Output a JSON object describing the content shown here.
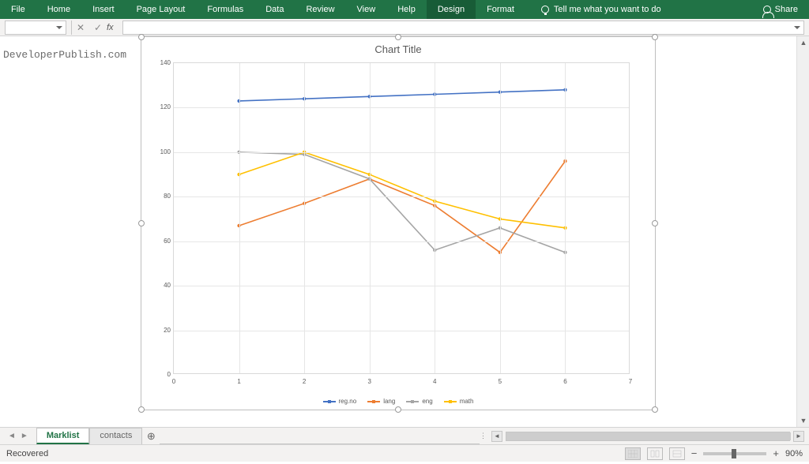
{
  "ribbon": {
    "tabs": [
      "File",
      "Home",
      "Insert",
      "Page Layout",
      "Formulas",
      "Data",
      "Review",
      "View",
      "Help",
      "Design",
      "Format"
    ],
    "active": "Design",
    "tellme": "Tell me what you want to do",
    "share": "Share"
  },
  "formula": {
    "name_box": "",
    "fx": "fx",
    "bar": ""
  },
  "watermark": "DeveloperPublish.com",
  "sheets": {
    "tabs": [
      "Marklist",
      "contacts"
    ],
    "active": "Marklist"
  },
  "status": {
    "left": "Recovered",
    "zoom": "90%"
  },
  "chart_data": {
    "type": "line",
    "title": "Chart Title",
    "xlabel": "",
    "ylabel": "",
    "xlim": [
      0,
      7
    ],
    "ylim": [
      0,
      140
    ],
    "x": [
      1,
      2,
      3,
      4,
      5,
      6
    ],
    "yticks": [
      0,
      20,
      40,
      60,
      80,
      100,
      120,
      140
    ],
    "xticks": [
      0,
      1,
      2,
      3,
      4,
      5,
      6,
      7
    ],
    "series": [
      {
        "name": "reg.no",
        "color": "#4472C4",
        "values": [
          123,
          124,
          125,
          126,
          127,
          128
        ]
      },
      {
        "name": "lang",
        "color": "#ED7D31",
        "values": [
          67,
          77,
          88,
          76,
          55,
          96
        ]
      },
      {
        "name": "eng",
        "color": "#A5A5A5",
        "values": [
          100,
          99,
          88,
          56,
          66,
          55
        ]
      },
      {
        "name": "math",
        "color": "#FFC000",
        "values": [
          90,
          100,
          90,
          78,
          70,
          66
        ]
      }
    ]
  }
}
